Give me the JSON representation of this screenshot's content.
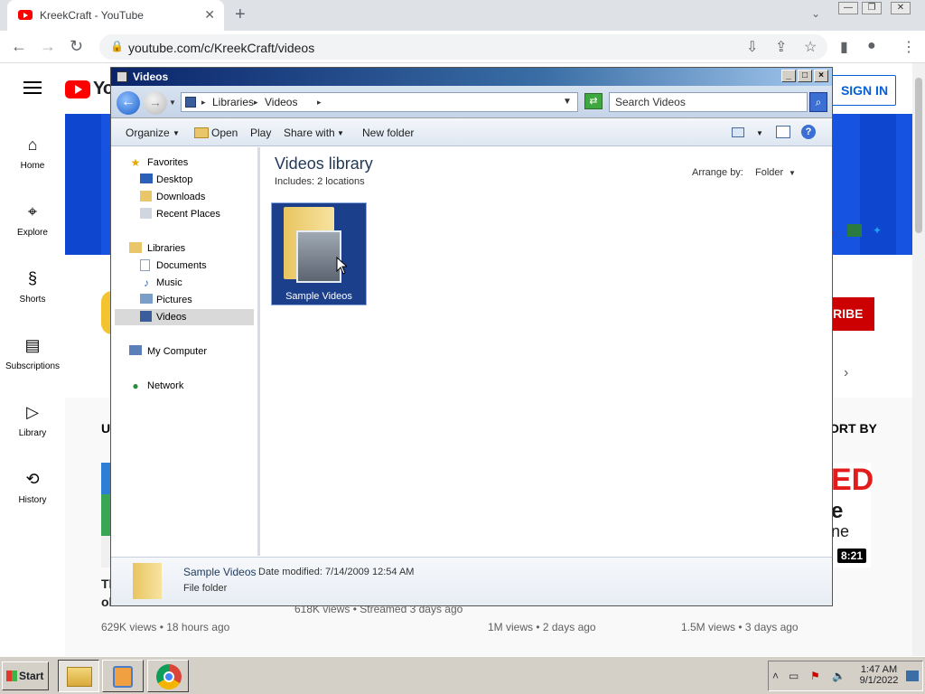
{
  "browser": {
    "tab_title": "KreekCraft - YouTube",
    "new_tab": "+",
    "close_tab": "✕",
    "tab_dropdown": "⌄",
    "url": "youtube.com/c/KreekCraft/videos",
    "window_min": "—",
    "window_max": "❐",
    "window_close": "✕"
  },
  "youtube": {
    "logo_text": "Yo",
    "sign_in": "SIGN IN",
    "guide": [
      {
        "label": "Home",
        "icon": "⌂"
      },
      {
        "label": "Explore",
        "icon": "⌖"
      },
      {
        "label": "Shorts",
        "icon": "§"
      },
      {
        "label": "Subscriptions",
        "icon": "▤"
      },
      {
        "label": "Library",
        "icon": "▷"
      },
      {
        "label": "History",
        "icon": "⟲"
      }
    ],
    "subscribe_partial": "RIBE",
    "uploads_partial": "U",
    "sort_by_partial": "ORT BY",
    "video_duration": "8:21",
    "meta": [
      "629K views • 18 hours ago",
      "618K views • Streamed 3 days ago",
      "1M views • 2 days ago",
      "1.5M views • 3 days ago"
    ],
    "title_partial_1": "Tl",
    "title_partial_2": "ol",
    "red_partial": "ED",
    "line_e": "e",
    "line_ne": "ne"
  },
  "explorer": {
    "title": "Videos",
    "breadcrumb": [
      "Libraries",
      "Videos"
    ],
    "search_placeholder": "Search Videos",
    "commands": {
      "organize": "Organize",
      "open": "Open",
      "play": "Play",
      "share_with": "Share with",
      "new_folder": "New folder"
    },
    "nav": {
      "favorites": "Favorites",
      "desktop": "Desktop",
      "downloads": "Downloads",
      "recent_places": "Recent Places",
      "libraries": "Libraries",
      "documents": "Documents",
      "music": "Music",
      "pictures": "Pictures",
      "videos": "Videos",
      "my_computer": "My Computer",
      "network": "Network"
    },
    "library_title": "Videos library",
    "includes": "Includes:  2 locations",
    "arrange_by_label": "Arrange by:",
    "arrange_by_value": "Folder",
    "folder_name": "Sample Videos",
    "details": {
      "name": "Sample Videos",
      "modified": "Date modified:  7/14/2009 12:54 AM",
      "type": "File folder"
    }
  },
  "taskbar": {
    "start": "Start",
    "clock_time": "1:47 AM",
    "clock_date": "9/1/2022"
  }
}
